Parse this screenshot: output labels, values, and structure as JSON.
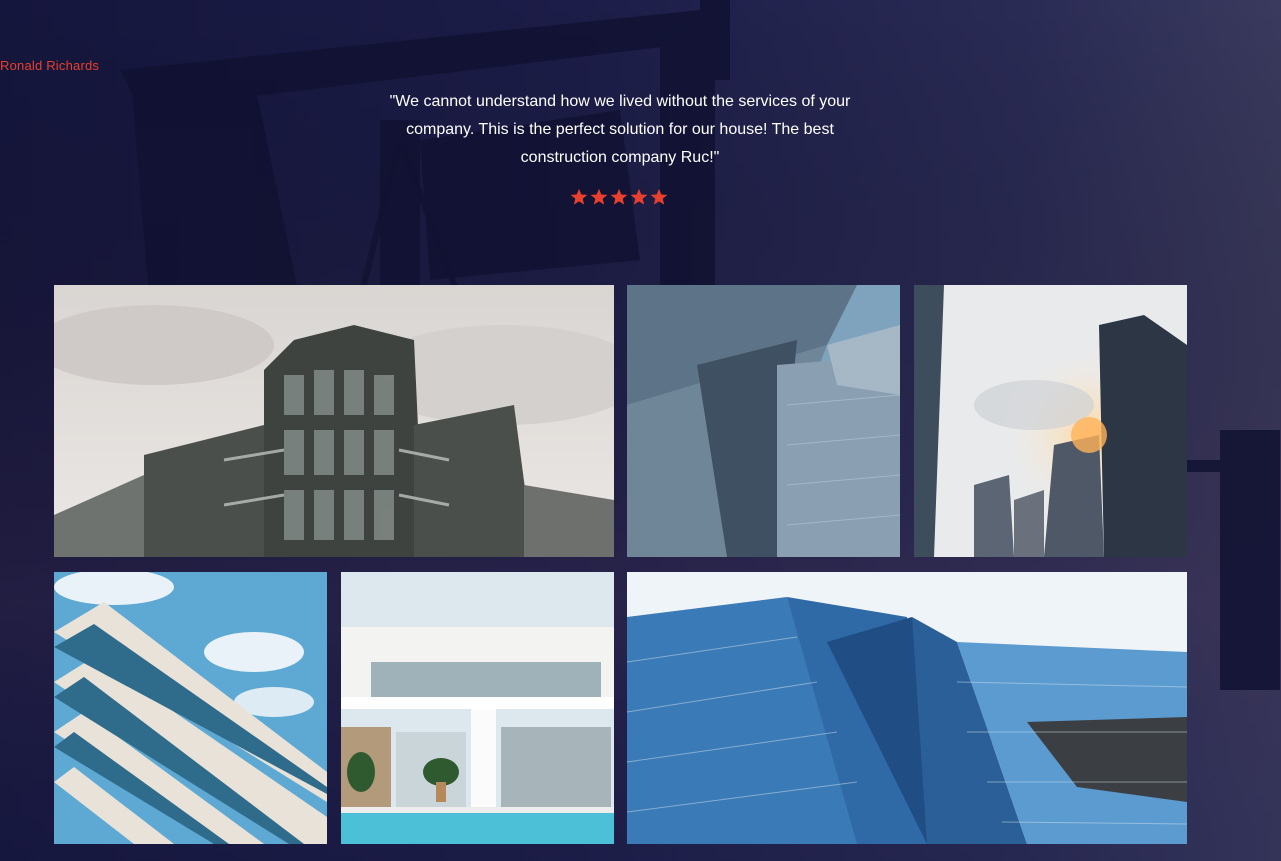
{
  "testimonial": {
    "author": "Ronald Richards",
    "quote": "\"We cannot understand how we lived without the services of your company. This is the perfect solution for our house! The best construction company Ruc!\"",
    "rating": 5
  },
  "gallery": {
    "images": [
      {
        "subject": "curved-glass-apartment-building"
      },
      {
        "subject": "metallic-curved-facade"
      },
      {
        "subject": "glass-skyscrapers-sunlight"
      },
      {
        "subject": "striped-balcony-building-sky"
      },
      {
        "subject": "modern-white-villa-pool"
      },
      {
        "subject": "blue-glass-towers-upward-view"
      }
    ]
  },
  "colors": {
    "accent": "#e8402d",
    "overlay": "#1b1c45",
    "text": "#ffffff"
  }
}
